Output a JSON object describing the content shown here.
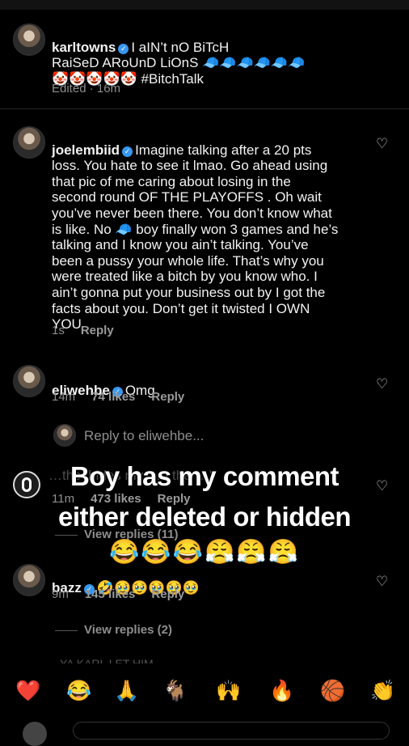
{
  "comments": [
    {
      "user": "karltowns",
      "text": "I aIN’t nO BiTcH\nRaiSeD ARoUnD LiOnS 🧢🧢🧢🧢🧢🧢\n🤡🤡🤡🤡🤡 #BitchTalk",
      "time": "Edited · 16m"
    },
    {
      "user": "joelembiid",
      "text": "Imagine talking after a 20 pts\nloss. You hate to see it lmao. Go ahead using\nthat pic of me caring about losing in the\nsecond round OF THE PLAYOFFS . Oh wait\nyou’ve never been there. You don’t know what\nis like. No 🧢 boy finally won 3 games and he’s\ntalking and I know you ain’t talking. You’ve\nbeen a pussy your whole life. That’s why you\nwere treated like a bitch by you know who. I\nain’t gonna put your business out by I got the\nfacts about you. Don’t get it twisted I OWN\nYOU",
      "time": "1s",
      "reply": "Reply"
    },
    {
      "user": "eliwehbe",
      "text": "Omg",
      "time": "14m",
      "likes": "74 likes",
      "reply": "Reply"
    },
    {
      "hidden_text": "…the ‘hides my …n the …’",
      "time": "11m",
      "likes": "473 likes",
      "reply": "Reply",
      "view_replies": "View replies (11)"
    },
    {
      "user": "bazz",
      "text": "🤣🥹🥹🥹🥹🥹",
      "time": "9m",
      "likes": "145 likes",
      "reply": "Reply",
      "view_replies": "View replies (2)"
    }
  ],
  "reply_prompt": "Reply to eliwehbe...",
  "overlay": {
    "line1": "Boy has my comment",
    "line2": "either deleted or hidden",
    "emojis": "😂😂😂😤😤😤"
  },
  "next_comment_cut": "…YA KARL LET HIM",
  "emoji_bar": [
    "❤️",
    "😂",
    "🙏",
    "🐐",
    "🙌",
    "🔥",
    "🏀",
    "👏"
  ],
  "icons": {
    "heart": "heart-icon",
    "verified": "verified-badge-icon"
  }
}
